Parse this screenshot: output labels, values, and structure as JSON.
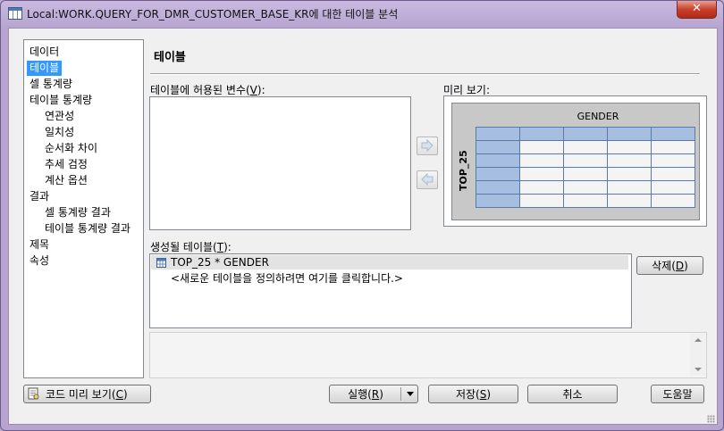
{
  "window": {
    "title": "Local:WORK.QUERY_FOR_DMR_CUSTOMER_BASE_KR에 대한 테이블 분석",
    "close_glyph": "✕"
  },
  "nav": {
    "items": [
      {
        "label": "데이터",
        "selected": false,
        "indent": 0
      },
      {
        "label": "테이블",
        "selected": true,
        "indent": 0
      },
      {
        "label": "셀 통계량",
        "selected": false,
        "indent": 0
      },
      {
        "label": "테이블 통계량",
        "selected": false,
        "indent": 0
      },
      {
        "label": "연관성",
        "selected": false,
        "indent": 1
      },
      {
        "label": "일치성",
        "selected": false,
        "indent": 1
      },
      {
        "label": "순서화 차이",
        "selected": false,
        "indent": 1
      },
      {
        "label": "추세 검정",
        "selected": false,
        "indent": 1
      },
      {
        "label": "계산 옵션",
        "selected": false,
        "indent": 1
      },
      {
        "label": "결과",
        "selected": false,
        "indent": 0
      },
      {
        "label": "셀 통계량 결과",
        "selected": false,
        "indent": 1
      },
      {
        "label": "테이블 통계량 결과",
        "selected": false,
        "indent": 1
      },
      {
        "label": "제목",
        "selected": false,
        "indent": 0
      },
      {
        "label": "속성",
        "selected": false,
        "indent": 0
      }
    ]
  },
  "panel": {
    "title": "테이블",
    "vars_label_pre": "테이블에 허용된 변수(",
    "vars_label_key": "V",
    "vars_label_post": "):",
    "preview_label": "미리 보기:",
    "preview_column_var": "GENDER",
    "preview_row_var": "TOP_25",
    "tables_label_pre": "생성될 테이블(",
    "tables_label_key": "T",
    "tables_label_post": "):",
    "tables": [
      {
        "label": "TOP_25 * GENDER",
        "selected": true,
        "icon": "table-icon"
      },
      {
        "label": "<새로운 테이블을 정의하려면 여기를 클릭합니다.>",
        "selected": false,
        "icon": ""
      }
    ],
    "delete_pre": "삭제(",
    "delete_key": "D",
    "delete_post": ")"
  },
  "footer": {
    "preview_code_pre": "코드 미리 보기(",
    "preview_code_key": "C",
    "preview_code_post": ")",
    "run_pre": "실행(",
    "run_key": "R",
    "run_post": ")",
    "save_pre": "저장(",
    "save_key": "S",
    "save_post": ")",
    "cancel": "취소",
    "help": "도움말"
  },
  "colors": {
    "selection": "#3399ff",
    "grid_header": "#a6bfe0",
    "grid_border": "#5a7aa8",
    "frame": "#b7a5d0"
  }
}
